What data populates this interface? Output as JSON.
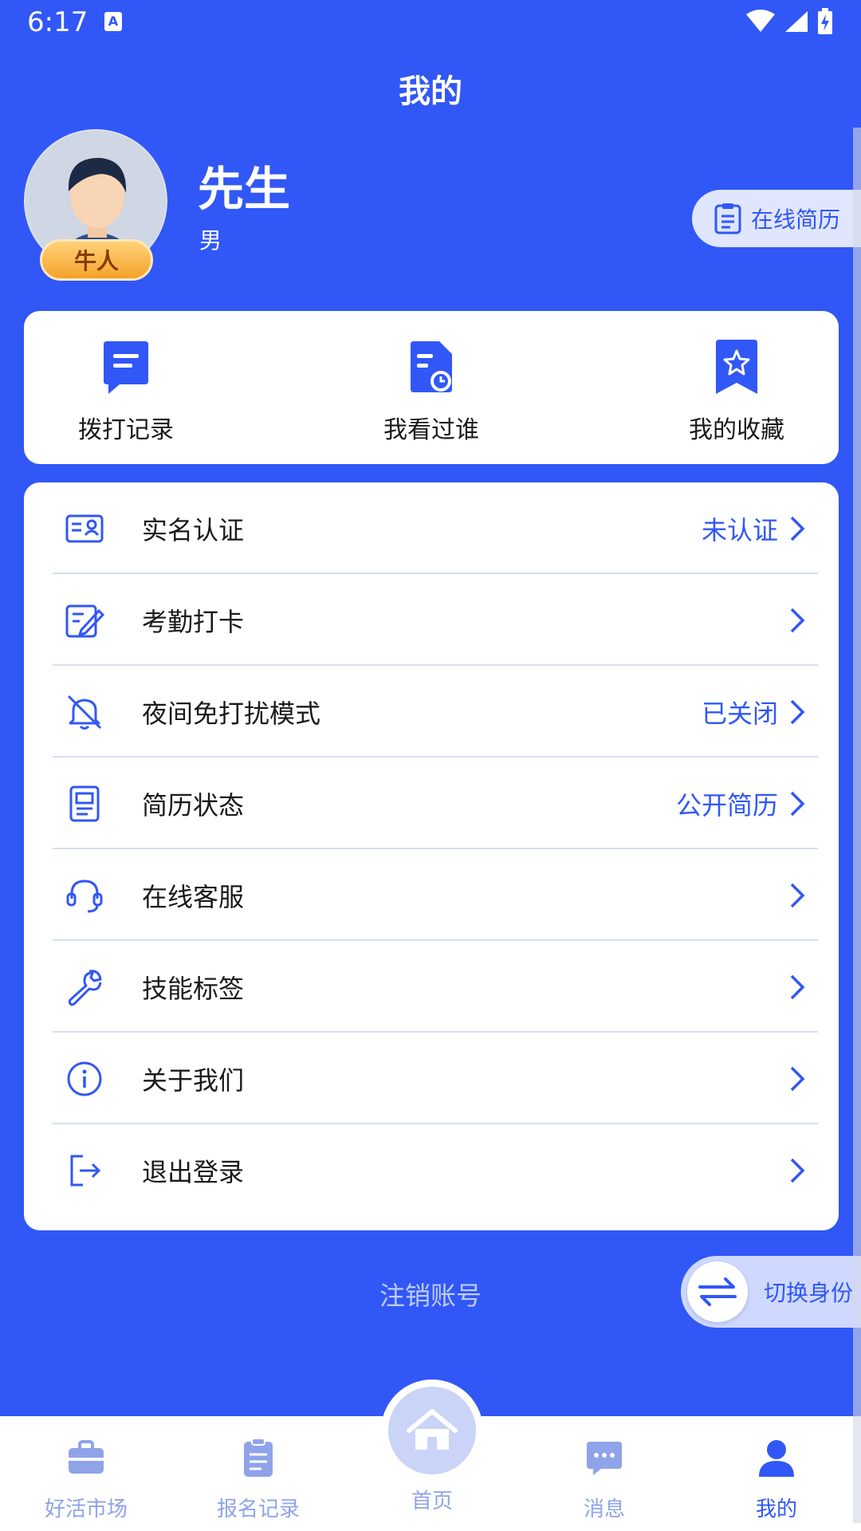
{
  "status_bar": {
    "time": "6:17"
  },
  "header": {
    "title": "我的"
  },
  "profile": {
    "name": "先生",
    "gender": "男",
    "badge": "牛人",
    "resume_button": "在线简历"
  },
  "quick_actions": [
    {
      "label": "拨打记录",
      "icon": "call-log-icon"
    },
    {
      "label": "我看过谁",
      "icon": "viewed-history-icon"
    },
    {
      "label": "我的收藏",
      "icon": "favorites-icon"
    }
  ],
  "menu": [
    {
      "label": "实名认证",
      "value": "未认证",
      "icon": "id-card-icon"
    },
    {
      "label": "考勤打卡",
      "value": "",
      "icon": "attendance-icon"
    },
    {
      "label": "夜间免打扰模式",
      "value": "已关闭",
      "icon": "bell-off-icon"
    },
    {
      "label": "简历状态",
      "value": "公开简历",
      "icon": "document-icon"
    },
    {
      "label": "在线客服",
      "value": "",
      "icon": "headset-icon"
    },
    {
      "label": "技能标签",
      "value": "",
      "icon": "wrench-icon"
    },
    {
      "label": "关于我们",
      "value": "",
      "icon": "info-icon"
    },
    {
      "label": "退出登录",
      "value": "",
      "icon": "logout-icon"
    }
  ],
  "cancel_account": "注销账号",
  "switch_identity": "切换身份",
  "bottom_nav": [
    {
      "label": "好活市场",
      "icon": "briefcase-icon",
      "active": false
    },
    {
      "label": "报名记录",
      "icon": "clipboard-icon",
      "active": false
    },
    {
      "label": "首页",
      "icon": "home-icon",
      "active": false
    },
    {
      "label": "消息",
      "icon": "message-icon",
      "active": false
    },
    {
      "label": "我的",
      "icon": "user-icon",
      "active": true
    }
  ],
  "colors": {
    "primary": "#3157F6",
    "background": "#3157F6",
    "card": "#FFFFFF"
  }
}
